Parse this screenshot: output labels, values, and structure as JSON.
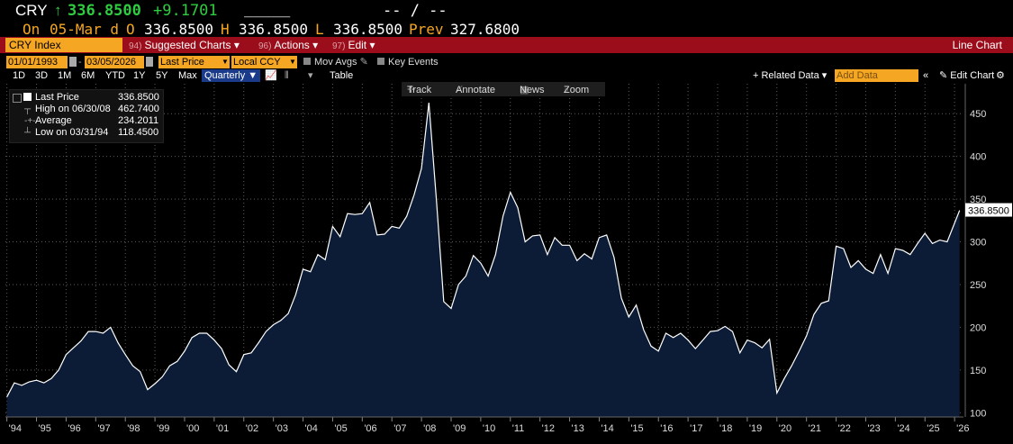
{
  "quote": {
    "ticker": "CRY",
    "arrow": "↑",
    "last": "336.8500",
    "change": "+9.1701",
    "blank": "_____",
    "dashes": "-- / --",
    "on_label": "On",
    "date": "05-Mar d",
    "open_label": "O",
    "open": "336.8500",
    "high_label": "H",
    "high": "336.8500",
    "low_label": "L",
    "low": "336.8500",
    "prev_label": "Prev",
    "prev": "327.6800"
  },
  "cmdbar": {
    "security": "CRY Index",
    "menus": [
      {
        "num": "94)",
        "label": "Suggested Charts ▾"
      },
      {
        "num": "96)",
        "label": "Actions ▾"
      },
      {
        "num": "97)",
        "label": "Edit ▾"
      }
    ],
    "chart_type": "Line Chart"
  },
  "toolbar": {
    "start_date": "01/01/1993",
    "end_date": "03/05/2026",
    "field": "Last Price",
    "currency": "Local CCY",
    "mov_avgs": "Mov Avgs",
    "key_events": "Key Events",
    "periods": [
      "1D",
      "3D",
      "1M",
      "6M",
      "YTD",
      "1Y",
      "5Y",
      "Max"
    ],
    "frequency": "Quarterly ▼",
    "table_label": "Table",
    "related_data": "+ Related Data ▾",
    "add_data_placeholder": "Add Data",
    "edit_chart": "Edit Chart"
  },
  "tools": {
    "track": "Track",
    "annotate": "Annotate",
    "news": "News",
    "zoom": "Zoom"
  },
  "legend": {
    "last_label": "Last Price",
    "last_value": "336.8500",
    "high_label": "High on 06/30/08",
    "high_value": "462.7400",
    "avg_label": "Average",
    "avg_value": "234.2011",
    "low_label": "Low on 03/31/94",
    "low_value": "118.4500"
  },
  "colors": {
    "line": "#ffffff",
    "fill": "#0c1c36",
    "accent": "#f5a623",
    "up": "#2ecc40",
    "bar": "#9b0d1b"
  },
  "chart_data": {
    "type": "area",
    "title": "",
    "xlabel": "",
    "ylabel": "",
    "ylim": [
      95,
      485
    ],
    "xlim": [
      1993.95,
      2026.3
    ],
    "yticks": [
      100,
      150,
      200,
      250,
      300,
      350,
      400,
      450
    ],
    "xticks": [
      "'94",
      "'95",
      "'96",
      "'97",
      "'98",
      "'99",
      "'00",
      "'01",
      "'02",
      "'03",
      "'04",
      "'05",
      "'06",
      "'07",
      "'08",
      "'09",
      "'10",
      "'11",
      "'12",
      "'13",
      "'14",
      "'15",
      "'16",
      "'17",
      "'18",
      "'19",
      "'20",
      "'21",
      "'22",
      "'23",
      "'24",
      "'25",
      "'26"
    ],
    "last_value_label": "336.8500",
    "grid": true,
    "series": [
      {
        "x": [
          1994.0,
          1994.25,
          1994.5,
          1994.75,
          1995.0,
          1995.25,
          1995.5,
          1995.75,
          1996.0,
          1996.25,
          1996.5,
          1996.75,
          1997.0,
          1997.25,
          1997.5,
          1997.75,
          1998.0,
          1998.25,
          1998.5,
          1998.75,
          1999.0,
          1999.25,
          1999.5,
          1999.75,
          2000.0,
          2000.25,
          2000.5,
          2000.75,
          2001.0,
          2001.25,
          2001.5,
          2001.75,
          2002.0,
          2002.25,
          2002.5,
          2002.75,
          2003.0,
          2003.25,
          2003.5,
          2003.75,
          2004.0,
          2004.25,
          2004.5,
          2004.75,
          2005.0,
          2005.25,
          2005.5,
          2005.75,
          2006.0,
          2006.25,
          2006.5,
          2006.75,
          2007.0,
          2007.25,
          2007.5,
          2007.75,
          2008.0,
          2008.25,
          2008.5,
          2008.75,
          2009.0,
          2009.25,
          2009.5,
          2009.75,
          2010.0,
          2010.25,
          2010.5,
          2010.75,
          2011.0,
          2011.25,
          2011.5,
          2011.75,
          2012.0,
          2012.25,
          2012.5,
          2012.75,
          2013.0,
          2013.25,
          2013.5,
          2013.75,
          2014.0,
          2014.25,
          2014.5,
          2014.75,
          2015.0,
          2015.25,
          2015.5,
          2015.75,
          2016.0,
          2016.25,
          2016.5,
          2016.75,
          2017.0,
          2017.25,
          2017.5,
          2017.75,
          2018.0,
          2018.25,
          2018.5,
          2018.75,
          2019.0,
          2019.25,
          2019.5,
          2019.75,
          2020.0,
          2020.25,
          2020.5,
          2020.75,
          2021.0,
          2021.25,
          2021.5,
          2021.75,
          2022.0,
          2022.25,
          2022.5,
          2022.75,
          2023.0,
          2023.25,
          2023.5,
          2023.75,
          2024.0,
          2024.25,
          2024.5,
          2024.75,
          2025.0,
          2025.25,
          2025.5,
          2025.75,
          2026.17
        ],
        "values": [
          118.45,
          135,
          132,
          136,
          138,
          135,
          140,
          150,
          168,
          176,
          184,
          195,
          195,
          193,
          200,
          182,
          168,
          155,
          148,
          127,
          134,
          142,
          155,
          160,
          172,
          188,
          193,
          193,
          185,
          175,
          156,
          148,
          168,
          170,
          182,
          195,
          203,
          208,
          216,
          238,
          268,
          265,
          285,
          279,
          318,
          306,
          333,
          332,
          333,
          346,
          308,
          309,
          318,
          316,
          330,
          355,
          386,
          462.74,
          350,
          230,
          222,
          250,
          260,
          284,
          275,
          260,
          285,
          330,
          358,
          340,
          300,
          307,
          308,
          285,
          305,
          296,
          296,
          278,
          286,
          280,
          305,
          308,
          282,
          234,
          212,
          226,
          197,
          178,
          172,
          193,
          188,
          193,
          185,
          175,
          185,
          195,
          196,
          201,
          195,
          170,
          185,
          182,
          176,
          186,
          123,
          140,
          155,
          172,
          190,
          215,
          228,
          231,
          295,
          292,
          270,
          278,
          268,
          263,
          285,
          263,
          292,
          290,
          285,
          298,
          310,
          298,
          302,
          300,
          336.85
        ]
      }
    ]
  }
}
